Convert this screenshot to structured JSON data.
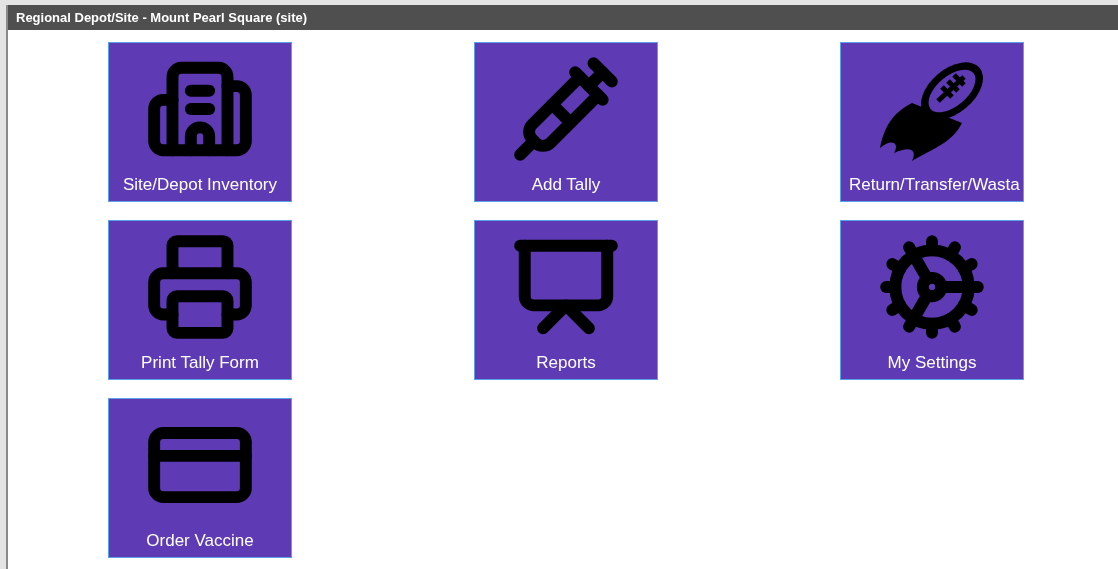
{
  "panel": {
    "title": "Regional Depot/Site - Mount Pearl Square (site)"
  },
  "tiles": [
    {
      "kind": "building",
      "label": "Site/Depot Inventory"
    },
    {
      "kind": "syringe",
      "label": "Add Tally"
    },
    {
      "kind": "football",
      "label": "Return/Transfer/Wasta"
    },
    {
      "kind": "printer",
      "label": "Print Tally Form"
    },
    {
      "kind": "presentation",
      "label": "Reports"
    },
    {
      "kind": "gear",
      "label": "My Settings"
    },
    {
      "kind": "card",
      "label": "Order Vaccine"
    }
  ]
}
